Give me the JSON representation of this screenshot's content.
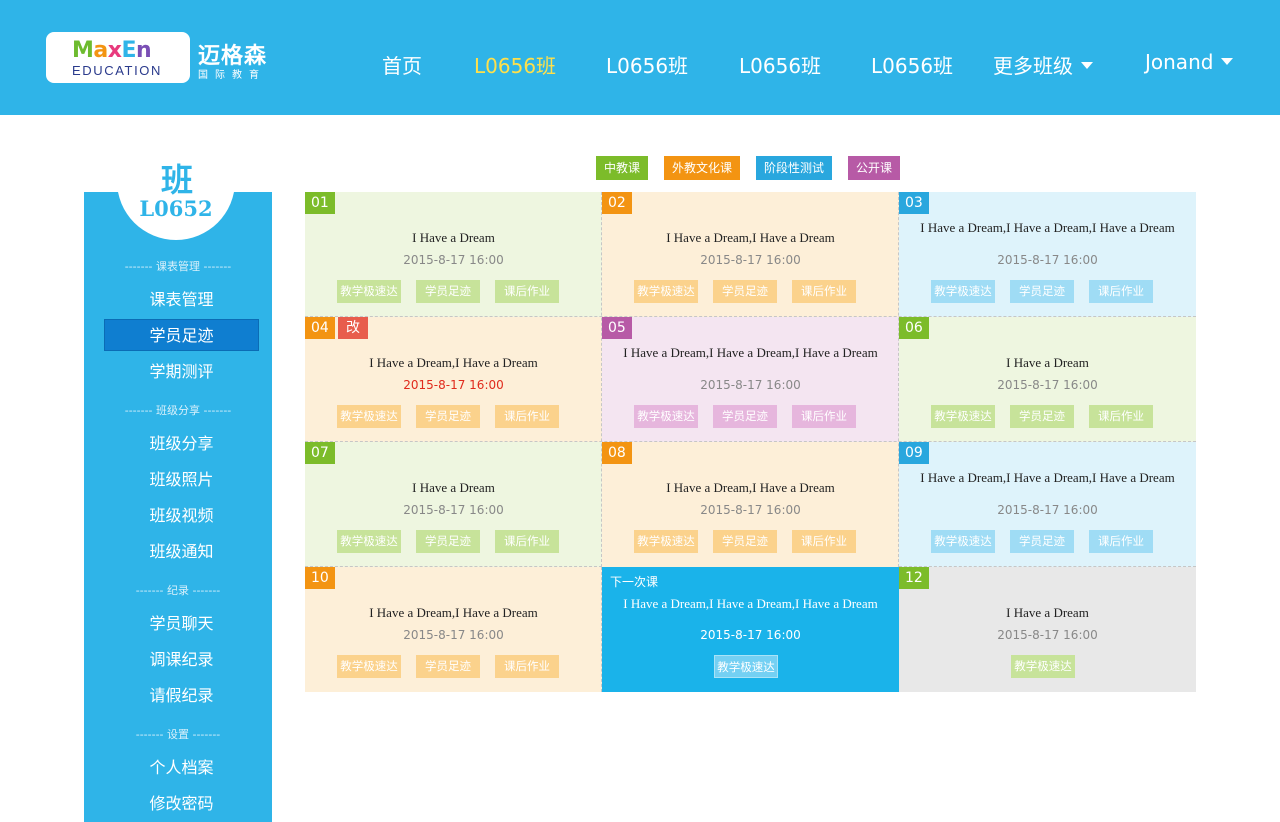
{
  "header": {
    "logo": {
      "brand_letters": [
        "M",
        "a",
        "x",
        "E",
        "n"
      ],
      "brand_colors": [
        "#6dbb2f",
        "#f39412",
        "#e83a7d",
        "#2fb4e8",
        "#7a4fb5"
      ],
      "sub": "EDUCATION",
      "cn": "迈格森",
      "cn_sub": "国际教育"
    },
    "nav": [
      {
        "label": "首页",
        "active": false
      },
      {
        "label": "L0656班",
        "active": true
      },
      {
        "label": "L0656班",
        "active": false
      },
      {
        "label": "L0656班",
        "active": false
      },
      {
        "label": "L0656班",
        "active": false
      },
      {
        "label": "更多班级",
        "active": false
      },
      {
        "label": "Jonand",
        "active": false
      }
    ]
  },
  "badge": {
    "ban": "班",
    "code": "L0652"
  },
  "sidebar": {
    "sections": [
      {
        "title": "------- 课表管理 -------",
        "items": [
          "课表管理",
          "学员足迹",
          "学期测评"
        ]
      },
      {
        "title": "------- 班级分享 -------",
        "items": [
          "班级分享",
          "班级照片",
          "班级视频",
          "班级通知"
        ]
      },
      {
        "title": "------- 纪录 -------",
        "items": [
          "学员聊天",
          "调课纪录",
          "请假纪录"
        ]
      },
      {
        "title": "------- 设置 -------",
        "items": [
          "个人档案",
          "修改密码"
        ]
      }
    ],
    "active_item": "学员足迹"
  },
  "legend": [
    {
      "label": "中教课",
      "color": "#7cbc2a"
    },
    {
      "label": "外教文化课",
      "color": "#f39412"
    },
    {
      "label": "阶段性测试",
      "color": "#29a7de"
    },
    {
      "label": "公开课",
      "color": "#b75aa6"
    }
  ],
  "buttons": {
    "speed": "教学极速达",
    "footprint": "学员足迹",
    "homework": "课后作业"
  },
  "lessons": [
    {
      "num": "01",
      "title": "I Have a Dream",
      "date": "2015-8-17  16:00",
      "type": "green"
    },
    {
      "num": "02",
      "title": "I Have a Dream,I Have a Dream",
      "date": "2015-8-17  16:00",
      "type": "orange"
    },
    {
      "num": "03",
      "title": "I Have a Dream,I Have a Dream,I Have a Dream",
      "date": "2015-8-17  16:00",
      "type": "blue"
    },
    {
      "num": "04",
      "tag": "改",
      "title": "I Have a Dream,I Have a Dream",
      "date": "2015-8-17  16:00",
      "type": "orange",
      "date_red": true
    },
    {
      "num": "05",
      "title": "I Have a Dream,I Have a Dream,I Have a Dream",
      "date": "2015-8-17  16:00",
      "type": "purple"
    },
    {
      "num": "06",
      "title": "I Have a Dream",
      "date": "2015-8-17  16:00",
      "type": "green"
    },
    {
      "num": "07",
      "title": "I Have a Dream",
      "date": "2015-8-17  16:00",
      "type": "green"
    },
    {
      "num": "08",
      "title": "I Have a Dream,I Have a Dream",
      "date": "2015-8-17  16:00",
      "type": "orange"
    },
    {
      "num": "09",
      "title": "I Have a Dream,I Have a Dream,I Have a Dream",
      "date": "2015-8-17  16:00",
      "type": "blue"
    },
    {
      "num": "10",
      "title": "I Have a Dream,I Have a Dream",
      "date": "2015-8-17  16:00",
      "type": "orange"
    },
    {
      "next_label": "下一次课",
      "title": "I Have a Dream,I Have a Dream,I Have a Dream",
      "date": "2015-8-17  16:00",
      "type": "next"
    },
    {
      "num": "12",
      "title": "I Have a Dream",
      "date": "2015-8-17  16:00",
      "type": "gray"
    }
  ]
}
